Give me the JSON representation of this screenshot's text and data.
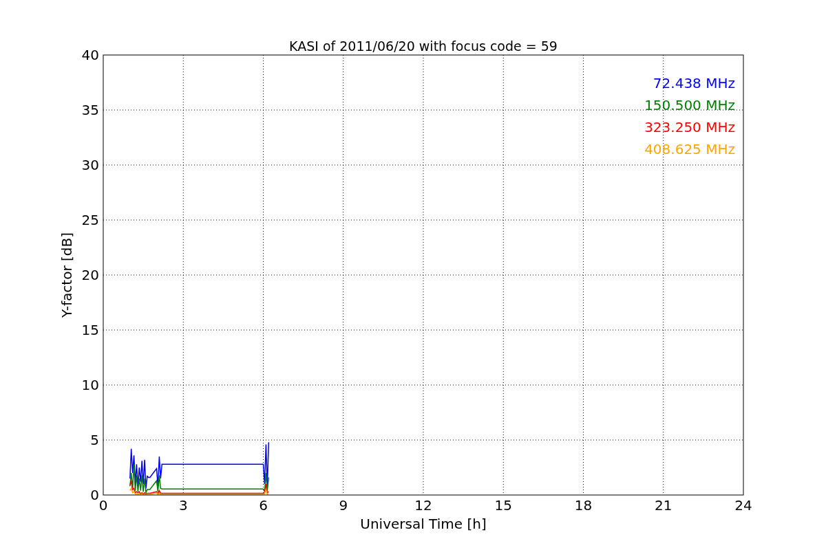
{
  "chart_data": {
    "type": "line",
    "title": "KASI of 2011/06/20 with focus code = 59",
    "xlabel": "Universal Time [h]",
    "ylabel": "Y-factor [dB]",
    "x": [
      1.0,
      1.05,
      1.1,
      1.15,
      1.2,
      1.25,
      1.3,
      1.35,
      1.4,
      1.45,
      1.5,
      1.55,
      1.6,
      1.65,
      1.7,
      1.75,
      2.0,
      2.05,
      2.1,
      2.15,
      2.2,
      6.0,
      6.05,
      6.1,
      6.15,
      6.2
    ],
    "series": [
      {
        "name": "72.438 MHz",
        "color": "#0000ff",
        "values": [
          1.5,
          4.2,
          2.0,
          3.6,
          1.0,
          2.8,
          0.8,
          2.5,
          1.2,
          3.1,
          1.0,
          3.2,
          0.6,
          1.7,
          1.6,
          1.6,
          2.4,
          0.8,
          3.5,
          1.5,
          2.8,
          2.8,
          1.0,
          4.6,
          0.8,
          4.8
        ]
      },
      {
        "name": "150.500 MHz",
        "color": "#008000",
        "values": [
          0.8,
          2.0,
          0.5,
          2.8,
          0.4,
          1.8,
          0.3,
          1.5,
          0.4,
          1.8,
          0.3,
          1.5,
          0.2,
          0.5,
          0.5,
          0.5,
          1.3,
          0.3,
          1.8,
          0.6,
          0.55,
          0.55,
          0.3,
          2.0,
          0.4,
          1.6
        ]
      },
      {
        "name": "323.250 MHz",
        "color": "#ff0000",
        "values": [
          0.9,
          1.2,
          0.5,
          0.6,
          0.2,
          0.3,
          0.2,
          0.3,
          0.1,
          0.2,
          0.1,
          0.2,
          0.1,
          0.15,
          0.15,
          0.15,
          0.3,
          0.1,
          0.4,
          0.15,
          0.15,
          0.15,
          0.2,
          1.0,
          0.2,
          0.3
        ]
      },
      {
        "name": "408.625 MHz",
        "color": "#ffa500",
        "values": [
          0.4,
          0.6,
          0.2,
          0.3,
          0.1,
          0.1,
          0.05,
          0.1,
          0.05,
          0.1,
          0.05,
          0.05,
          0.05,
          0.05,
          0.05,
          0.05,
          0.2,
          0.05,
          0.15,
          0.05,
          0.05,
          0.05,
          0.1,
          0.5,
          0.05,
          0.1
        ]
      }
    ],
    "xlim": [
      0,
      24
    ],
    "ylim": [
      0,
      40
    ],
    "xticks": [
      0,
      3,
      6,
      9,
      12,
      15,
      18,
      21,
      24
    ],
    "yticks": [
      0,
      5,
      10,
      15,
      20,
      25,
      30,
      35,
      40
    ],
    "grid": true
  }
}
